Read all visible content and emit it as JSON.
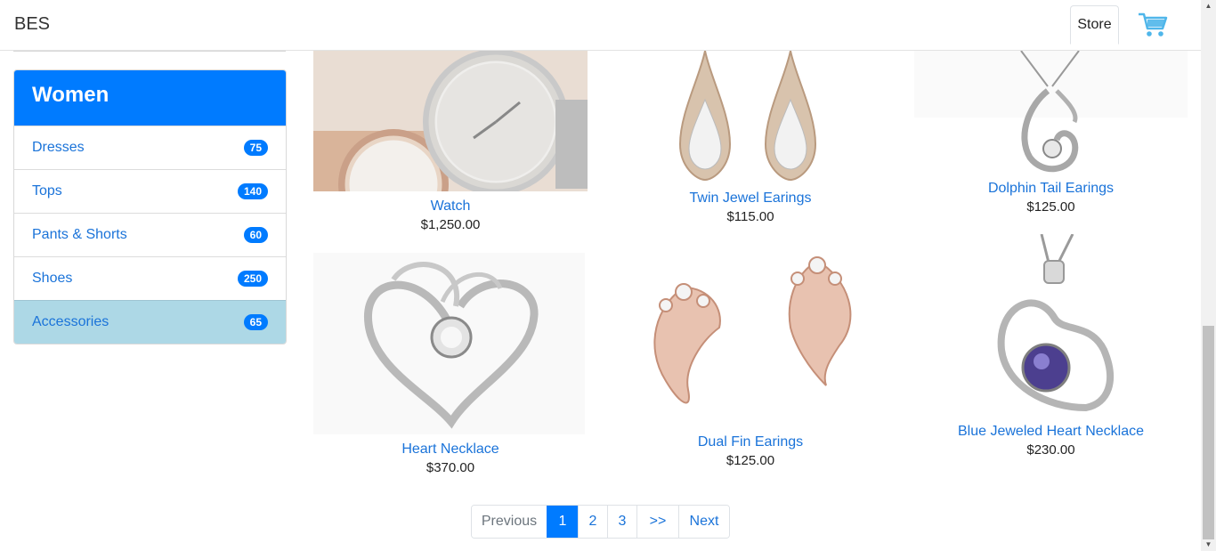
{
  "navbar": {
    "brand": "BES",
    "store_tab": "Store",
    "cart_icon": "shopping-cart-icon",
    "cart_color": "#4fb6ea"
  },
  "sidebar": {
    "title": "Women",
    "header_color": "#007bff",
    "items": [
      {
        "label": "Dresses",
        "count": "75",
        "active": false
      },
      {
        "label": "Tops",
        "count": "140",
        "active": false
      },
      {
        "label": "Pants & Shorts",
        "count": "60",
        "active": false
      },
      {
        "label": "Shoes",
        "count": "250",
        "active": false
      },
      {
        "label": "Accessories",
        "count": "65",
        "active": true
      }
    ]
  },
  "products": [
    {
      "name": "Watch",
      "price": "$1,250.00",
      "image": "rose-gold-watch-image"
    },
    {
      "name": "Twin Jewel Earings",
      "price": "$115.00",
      "image": "teardrop-earrings-image"
    },
    {
      "name": "Dolphin Tail Earings",
      "price": "$125.00",
      "image": "dolphin-pendant-image"
    },
    {
      "name": "Heart Necklace",
      "price": "$370.00",
      "image": "silver-heart-necklace-image"
    },
    {
      "name": "Dual Fin Earings",
      "price": "$125.00",
      "image": "rose-gold-fin-earrings-image"
    },
    {
      "name": "Blue Jeweled Heart Necklace",
      "price": "$230.00",
      "image": "blue-heart-necklace-image"
    }
  ],
  "pagination": {
    "previous": "Previous",
    "pages": [
      "1",
      "2",
      "3"
    ],
    "active_page": "1",
    "jump": ">>",
    "next": "Next"
  },
  "colors": {
    "link": "#1a73d9",
    "primary": "#007bff",
    "active_item": "#add8e6"
  }
}
